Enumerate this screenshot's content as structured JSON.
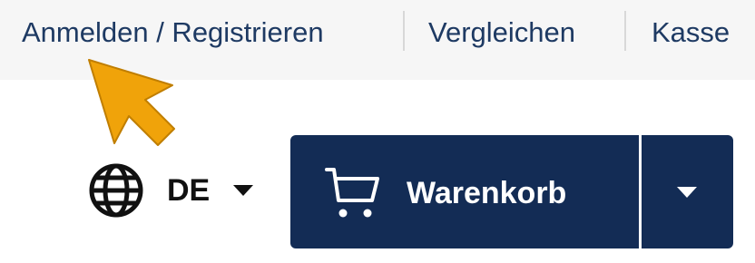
{
  "topbar": {
    "login_label": "Anmelden / Registrieren",
    "compare_label": "Vergleichen",
    "checkout_label": "Kasse"
  },
  "language": {
    "selected": "DE",
    "icon": "globe-icon"
  },
  "cart": {
    "label": "Warenkorb",
    "icon": "shopping-cart-icon"
  },
  "colors": {
    "primary": "#132c55",
    "link": "#1e3a63",
    "pointer": "#f0a30a"
  }
}
